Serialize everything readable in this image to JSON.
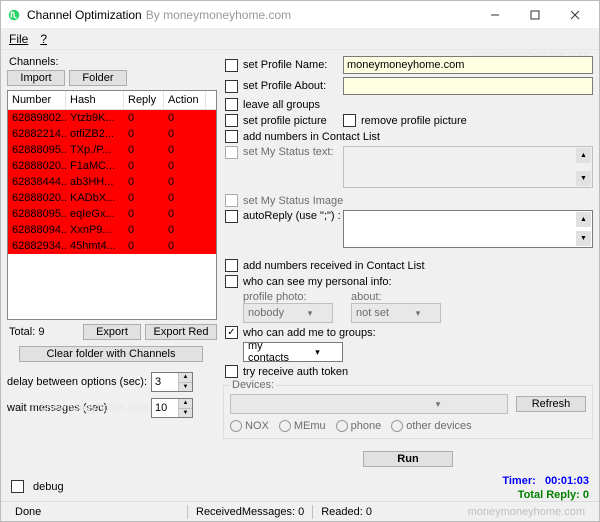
{
  "title": "Channel Optimization",
  "title_by": "By moneymoneyhome.com",
  "menu": {
    "file": "File",
    "help": "?"
  },
  "left": {
    "channels_label": "Channels:",
    "import_btn": "Import",
    "folder_btn": "Folder",
    "cols": {
      "number": "Number",
      "hash": "Hash",
      "reply": "Reply",
      "action": "Action"
    },
    "rows": [
      {
        "number": "62889802...",
        "hash": "Ytzb9K...",
        "reply": "0",
        "action": "0"
      },
      {
        "number": "62882214...",
        "hash": "otfiZB2...",
        "reply": "0",
        "action": "0"
      },
      {
        "number": "62888095...",
        "hash": "TXp./P...",
        "reply": "0",
        "action": "0"
      },
      {
        "number": "62888020...",
        "hash": "F1aMC...",
        "reply": "0",
        "action": "0"
      },
      {
        "number": "62838444...",
        "hash": "ab3HH...",
        "reply": "0",
        "action": "0"
      },
      {
        "number": "62888020...",
        "hash": "KADbX...",
        "reply": "0",
        "action": "0"
      },
      {
        "number": "62888095...",
        "hash": "eqIeGx...",
        "reply": "0",
        "action": "0"
      },
      {
        "number": "62888094...",
        "hash": "XxnP9...",
        "reply": "0",
        "action": "0"
      },
      {
        "number": "62882934...",
        "hash": "45hmt4...",
        "reply": "0",
        "action": "0"
      }
    ],
    "total": "Total: 9",
    "export_btn": "Export",
    "export_red_btn": "Export Red",
    "clear_btn": "Clear folder with Channels",
    "delay_label": "delay between options (sec):",
    "delay_val": "3",
    "wait_label": "wait messages (sec)",
    "wait_val": "10",
    "debug": "debug"
  },
  "right": {
    "profile_name": "set Profile Name:",
    "profile_name_val": "moneymoneyhome.com",
    "profile_about": "set Profile About:",
    "leave_groups": "leave all groups",
    "set_picture": "set profile picture",
    "remove_picture": "remove profile picture",
    "add_numbers": "add numbers in Contact List",
    "status_text": "set My Status text:",
    "status_image": "set My Status Image",
    "autoreply": "autoReply (use \";\") :",
    "add_received": "add numbers received in Contact List",
    "who_see": "who can see my personal info:",
    "profile_photo_lbl": "profile photo:",
    "profile_photo_val": "nobody",
    "about_lbl": "about:",
    "about_val": "not set",
    "who_add": "who can add me to groups:",
    "who_add_val": "my contacts",
    "try_token": "try receive auth token",
    "devices_lbl": "Devices:",
    "refresh_btn": "Refresh",
    "nox": "NOX",
    "memu": "MEmu",
    "phone": "phone",
    "other": "other devices",
    "run_btn": "Run",
    "timer_lbl": "Timer:",
    "timer_val": "00:01:03",
    "total_reply": "Total Reply: 0"
  },
  "status": {
    "done": "Done",
    "recv": "ReceivedMessages: 0",
    "readed": "Readed: 0",
    "site": "moneymoneyhome.com"
  },
  "watermark": "moneymoneyhome.com"
}
